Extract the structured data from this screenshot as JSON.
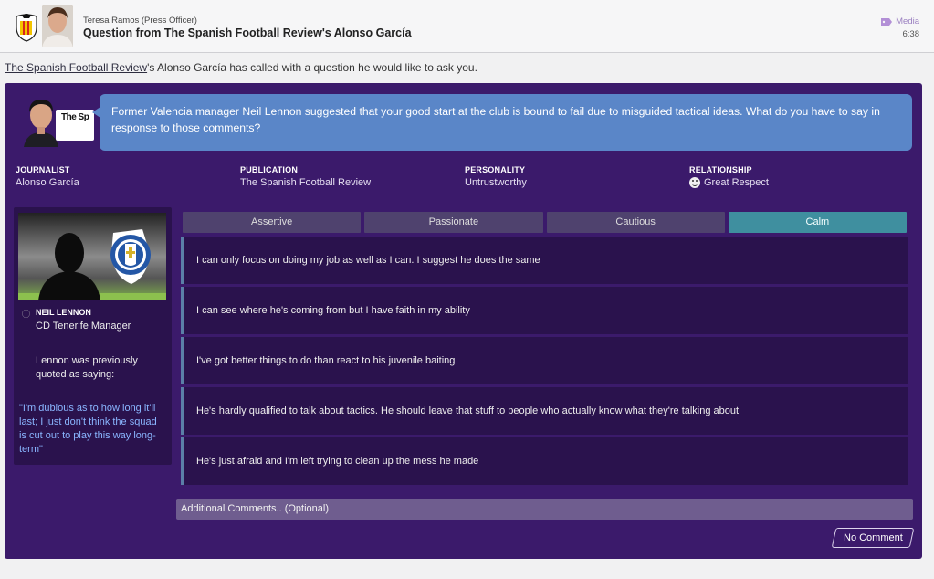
{
  "header": {
    "sender": "Teresa Ramos  (Press Officer)",
    "subject": "Question from The Spanish Football Review's Alonso García",
    "media_label": "Media",
    "time": "6:38"
  },
  "intro": {
    "publication": "The Spanish Football Review",
    "rest": "'s Alonso García has called with a question he would like to ask you."
  },
  "question": {
    "paper_logo": "The Sp",
    "text": "Former Valencia manager Neil Lennon suggested that your good start at the club is bound to fail due to misguided tactical ideas. What do you have to say in response to those comments?"
  },
  "journalist_info": {
    "journalist_label": "JOURNALIST",
    "journalist_value": "Alonso García",
    "publication_label": "PUBLICATION",
    "publication_value": "The Spanish Football Review",
    "personality_label": "PERSONALITY",
    "personality_value": "Untrustworthy",
    "relationship_label": "RELATIONSHIP",
    "relationship_value": "Great Respect"
  },
  "manager": {
    "name": "NEIL LENNON",
    "role": "CD Tenerife Manager",
    "lead": "Lennon was previously quoted as saying:",
    "quote": "\"I'm dubious as to how long it'll last; I just don't think the squad is cut out to play this way long-term\""
  },
  "tones": [
    "Assertive",
    "Passionate",
    "Cautious",
    "Calm"
  ],
  "active_tone": "Calm",
  "answers": [
    "I can only focus on doing my job as well as I can. I suggest he does the same",
    "I can see where he's coming from but I have faith in my ability",
    "I've got better things to do than react to his juvenile baiting",
    "He's hardly qualified to talk about tactics. He should leave that stuff to people who actually know what they're talking about",
    "He's just afraid and I'm left trying to clean up the mess he made"
  ],
  "additional_comments": "Additional Comments.. (Optional)",
  "no_comment": "No Comment",
  "colors": {
    "panel": "#3b1a6b",
    "bubble": "#5a86c8",
    "active_tab": "#3f8f9f",
    "quote_text": "#8ab6ff"
  }
}
